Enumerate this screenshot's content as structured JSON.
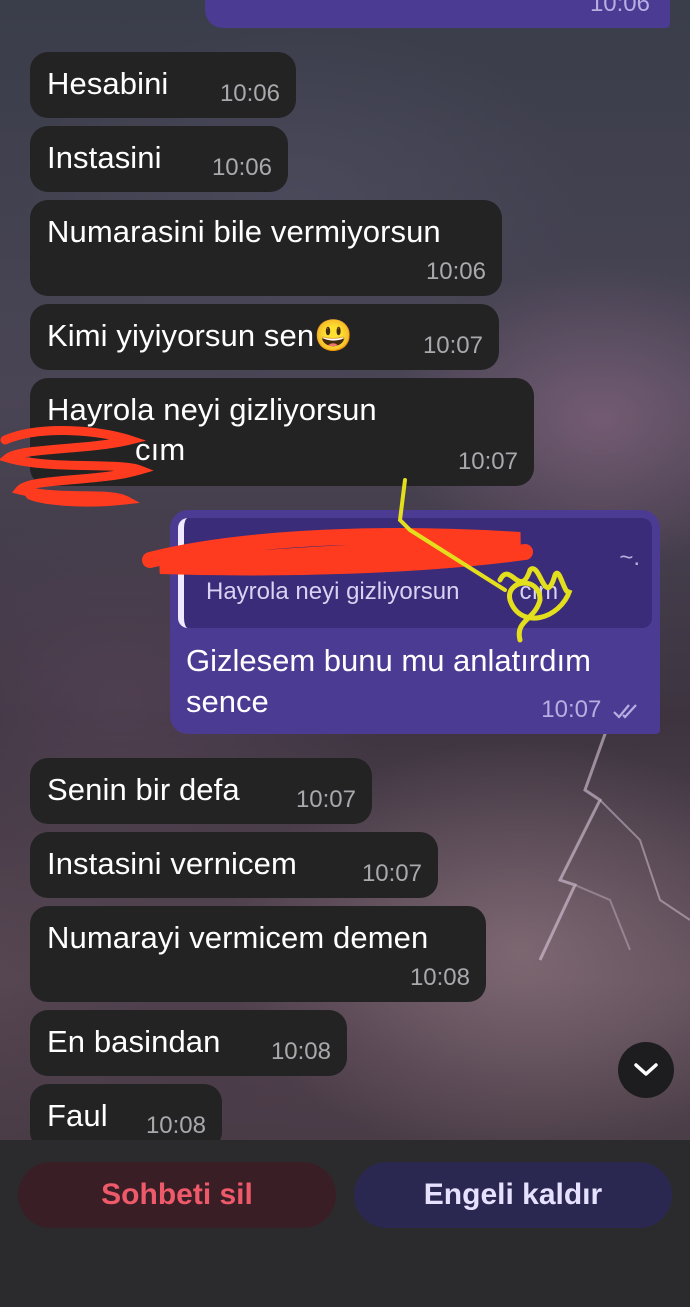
{
  "messages": [
    {
      "text": "Hesabini",
      "time": "10:06"
    },
    {
      "text": "Instasini",
      "time": "10:06"
    },
    {
      "text": "Numarasini bile vermiyorsun",
      "time": "10:06"
    },
    {
      "text": "Kimi yiyiyorsun sen😃",
      "time": "10:07"
    },
    {
      "text_line1": "Hayrola neyi gizliyorsun",
      "text_line2": "cım",
      "time": "10:07"
    },
    {
      "text": "Senin bir defa",
      "time": "10:07"
    },
    {
      "text": "Instasini vernicem",
      "time": "10:07"
    },
    {
      "text": "Numarayi vermicem demen",
      "time": "10:08"
    },
    {
      "text": "En basindan",
      "time": "10:08"
    },
    {
      "text": "Faul",
      "time": "10:08"
    }
  ],
  "top_partial": {
    "time": "10:06"
  },
  "reply": {
    "quote_text": "Hayrola neyi gizliyorsun",
    "quote_tail": "cım",
    "quote_symbol": "~.",
    "text_line1": "Gizlesem bunu mu anlatırdım",
    "text_line2": "sence",
    "time": "10:07"
  },
  "actions": {
    "delete_label": "Sohbeti sil",
    "unblock_label": "Engeli kaldır"
  },
  "colors": {
    "incoming": "#232324",
    "outgoing": "#4c3b93",
    "delete": "#ee5a6a"
  },
  "icons": {
    "read": "double-check-icon",
    "scroll": "chevron-down-icon"
  }
}
